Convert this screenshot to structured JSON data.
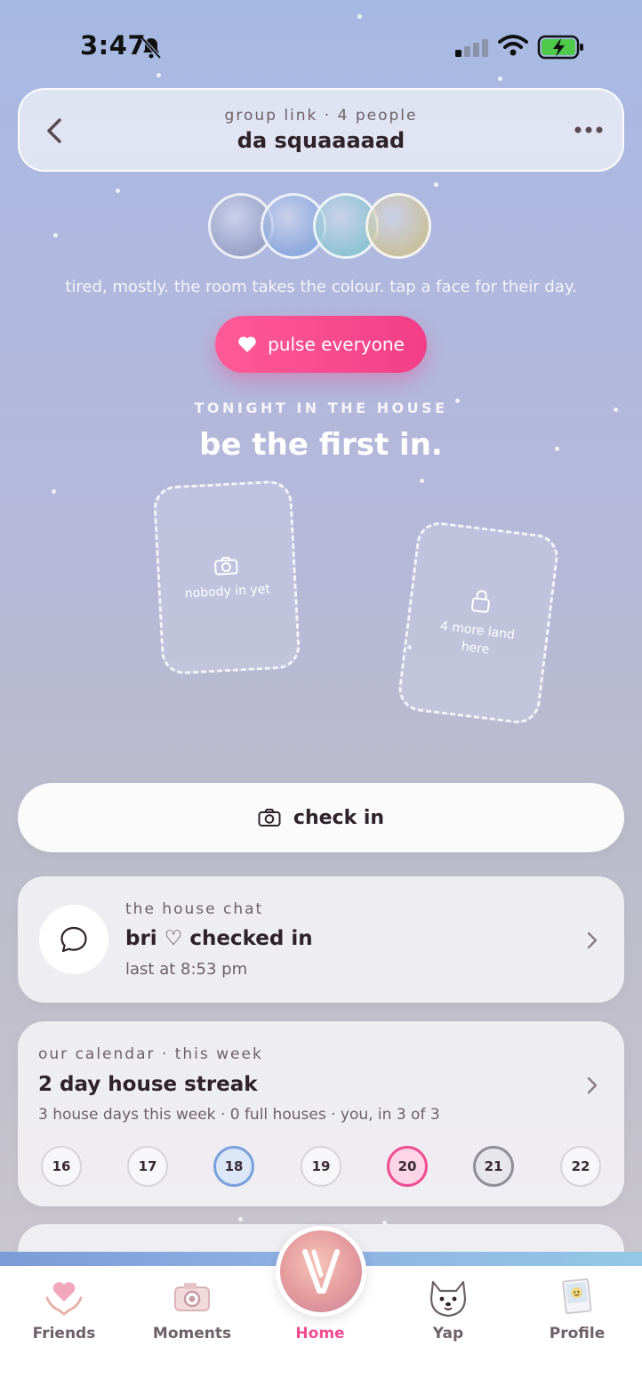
{
  "status_bar": {
    "time": "3:47"
  },
  "header": {
    "subtitle": "group link · 4 people",
    "title": "da squaaaaad"
  },
  "avatars": [
    {
      "color": "#9aa4c8"
    },
    {
      "color": "#8ea9dd"
    },
    {
      "color": "#8fc4d2"
    },
    {
      "color": "#c9c0a0"
    }
  ],
  "mood_text": "tired, mostly. the room takes the colour. tap a face for their day.",
  "pulse_button": {
    "label": "pulse everyone"
  },
  "tonight": {
    "label": "TONIGHT IN THE HOUSE",
    "title": "be the first in."
  },
  "slots": {
    "first": {
      "text": "nobody in yet",
      "icon": "camera-icon"
    },
    "second": {
      "text": "4 more land here",
      "icon": "lock-icon"
    }
  },
  "check_in_button": {
    "label": "check in"
  },
  "house_chat": {
    "label": "the house chat",
    "title": "bri ♡ checked in",
    "subtitle": "last at 8:53 pm"
  },
  "calendar": {
    "label": "our calendar · this week",
    "title": "2 day house streak",
    "subtitle": "3 house days this week · 0 full houses · you, in 3 of 3",
    "days": [
      {
        "num": "16",
        "state": "none"
      },
      {
        "num": "17",
        "state": "none"
      },
      {
        "num": "18",
        "state": "blue"
      },
      {
        "num": "19",
        "state": "none"
      },
      {
        "num": "20",
        "state": "pink"
      },
      {
        "num": "21",
        "state": "gray"
      },
      {
        "num": "22",
        "state": "none"
      }
    ]
  },
  "tabs": [
    {
      "label": "Friends",
      "icon": "hands-heart-icon"
    },
    {
      "label": "Moments",
      "icon": "camera-icon"
    },
    {
      "label": "Home",
      "icon": "home-logo-icon",
      "active": true,
      "accent": "#f04d93"
    },
    {
      "label": "Yap",
      "icon": "dog-icon"
    },
    {
      "label": "Profile",
      "icon": "polaroid-icon"
    }
  ]
}
